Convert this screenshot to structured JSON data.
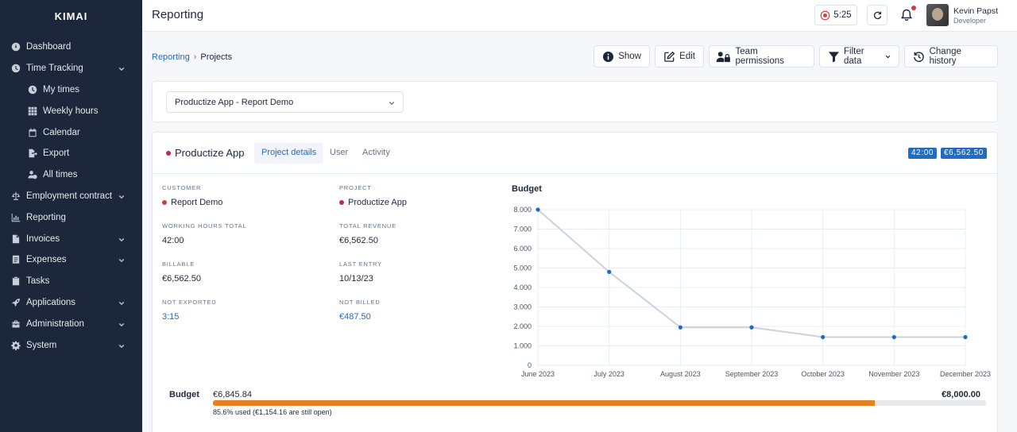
{
  "app": {
    "brand": "KIMAI"
  },
  "sidebar": {
    "items": [
      {
        "label": "Dashboard",
        "icon": "dashboard-icon",
        "sub": false,
        "chevron": false
      },
      {
        "label": "Time Tracking",
        "icon": "clock-icon",
        "sub": false,
        "chevron": true
      },
      {
        "label": "My times",
        "icon": "clock-icon",
        "sub": true,
        "chevron": false
      },
      {
        "label": "Weekly hours",
        "icon": "grid-icon",
        "sub": true,
        "chevron": false
      },
      {
        "label": "Calendar",
        "icon": "calendar-icon",
        "sub": true,
        "chevron": false
      },
      {
        "label": "Export",
        "icon": "export-file-icon",
        "sub": true,
        "chevron": false
      },
      {
        "label": "All times",
        "icon": "users-clock-icon",
        "sub": true,
        "chevron": false
      },
      {
        "label": "Employment contract",
        "icon": "scale-icon",
        "sub": false,
        "chevron": true
      },
      {
        "label": "Reporting",
        "icon": "chart-bars-icon",
        "sub": false,
        "chevron": false
      },
      {
        "label": "Invoices",
        "icon": "invoice-icon",
        "sub": false,
        "chevron": true
      },
      {
        "label": "Expenses",
        "icon": "receipt-icon",
        "sub": false,
        "chevron": true
      },
      {
        "label": "Tasks",
        "icon": "clipboard-icon",
        "sub": false,
        "chevron": false
      },
      {
        "label": "Applications",
        "icon": "rocket-icon",
        "sub": false,
        "chevron": true
      },
      {
        "label": "Administration",
        "icon": "toolbox-icon",
        "sub": false,
        "chevron": true
      },
      {
        "label": "System",
        "icon": "gear-icon",
        "sub": false,
        "chevron": true
      }
    ]
  },
  "header": {
    "title": "Reporting",
    "timer": "5:25",
    "user_name": "Kevin Papst",
    "user_role": "Developer"
  },
  "breadcrumb": {
    "parent": "Reporting",
    "separator": "›",
    "current": "Projects"
  },
  "toolbar": {
    "show": "Show",
    "edit": "Edit",
    "team_permissions": "Team permissions",
    "filter": "Filter data",
    "history": "Change history"
  },
  "project_select": {
    "value": "Productize App - Report Demo"
  },
  "project": {
    "name": "Productize App",
    "color": "#c2255c",
    "tabs": [
      "Project details",
      "User",
      "Activity"
    ],
    "badge_hours": "42:00",
    "badge_revenue": "€6,562.50"
  },
  "stats": {
    "customer_label": "CUSTOMER",
    "customer": "Report Demo",
    "customer_color": "#d63939",
    "project_label": "PROJECT",
    "project": "Productize App",
    "working_hours_label": "WORKING HOURS TOTAL",
    "working_hours": "42:00",
    "revenue_label": "TOTAL REVENUE",
    "revenue": "€6,562.50",
    "billable_label": "BILLABLE",
    "billable": "€6,562.50",
    "last_entry_label": "LAST ENTRY",
    "last_entry": "10/13/23",
    "not_exported_label": "NOT EXPORTED",
    "not_exported": "3:15",
    "not_billed_label": "NOT BILLED",
    "not_billed": "€487.50"
  },
  "chart_data": {
    "type": "line",
    "title": "Budget",
    "categories": [
      "June 2023",
      "July 2023",
      "August 2023",
      "September 2023",
      "October 2023",
      "November 2023",
      "December 2023"
    ],
    "series": [
      {
        "values": [
          8000,
          4800,
          1950,
          1950,
          1450,
          1450,
          1450
        ]
      }
    ],
    "ylim": [
      0,
      8000
    ],
    "yticks": [
      "0",
      "1.000",
      "2.000",
      "3.000",
      "4.000",
      "5.000",
      "6.000",
      "7.000",
      "8.000"
    ],
    "grid": true,
    "line_color": "#c8d2e0",
    "point_color": "#206bc4"
  },
  "budget": {
    "label": "Budget",
    "used": "€6,845.84",
    "total": "€8,000.00",
    "used_fraction": 0.856,
    "note": "85.6% used (€1,154.16 are still open)",
    "bar_color": "#e67e22"
  }
}
